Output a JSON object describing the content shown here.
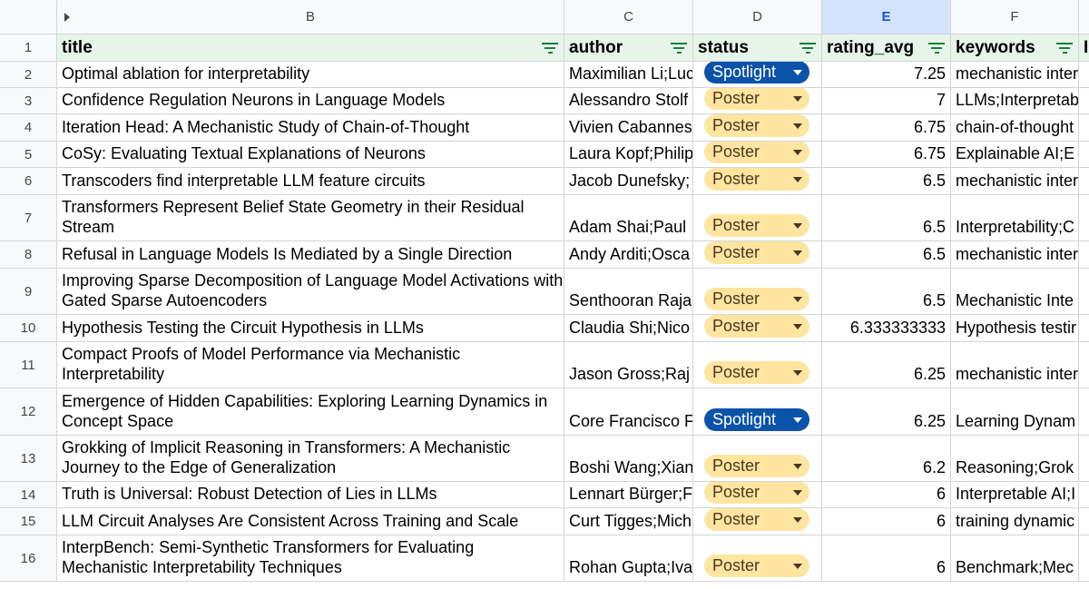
{
  "columns": [
    "B",
    "C",
    "D",
    "E",
    "F"
  ],
  "selected_column": "E",
  "headers": {
    "title": "title",
    "author": "author",
    "status": "status",
    "rating": "rating_avg",
    "keywords": "keywords",
    "next": "I"
  },
  "rows": [
    {
      "num": "1"
    },
    {
      "num": "2",
      "title": "Optimal ablation for interpretability",
      "author": "Maximilian Li;Luc",
      "status": "Spotlight",
      "rating": "7.25",
      "keywords": "mechanistic interp"
    },
    {
      "num": "3",
      "title": "Confidence Regulation Neurons in Language Models",
      "author": "Alessandro Stolf",
      "status": "Poster",
      "rating": "7",
      "keywords": "LLMs;Interpretab"
    },
    {
      "num": "4",
      "title": "Iteration Head: A Mechanistic Study of Chain-of-Thought",
      "author": "Vivien Cabannes",
      "status": "Poster",
      "rating": "6.75",
      "keywords": "chain-of-thought"
    },
    {
      "num": "5",
      "title": "CoSy: Evaluating Textual Explanations of Neurons",
      "author": "Laura Kopf;Philip",
      "status": "Poster",
      "rating": "6.75",
      "keywords": "Explainable AI;E"
    },
    {
      "num": "6",
      "title": "Transcoders find interpretable LLM feature circuits",
      "author": "Jacob Dunefsky;",
      "status": "Poster",
      "rating": "6.5",
      "keywords": "mechanistic inter"
    },
    {
      "num": "7",
      "title": "Transformers Represent Belief State Geometry in their Residual Stream",
      "author": "Adam Shai;Paul",
      "status": "Poster",
      "rating": "6.5",
      "keywords": "Interpretability;C"
    },
    {
      "num": "8",
      "title": "Refusal in Language Models Is Mediated by a Single Direction",
      "author": "Andy Arditi;Osca",
      "status": "Poster",
      "rating": "6.5",
      "keywords": "mechanistic inter"
    },
    {
      "num": "9",
      "title": "Improving Sparse Decomposition of Language Model Activations with Gated Sparse Autoencoders",
      "author": "Senthooran Raja",
      "status": "Poster",
      "rating": "6.5",
      "keywords": "Mechanistic Inte"
    },
    {
      "num": "10",
      "title": "Hypothesis Testing the Circuit Hypothesis in LLMs",
      "author": "Claudia Shi;Nico",
      "status": "Poster",
      "rating": "6.333333333",
      "keywords": "Hypothesis testir"
    },
    {
      "num": "11",
      "title": "Compact Proofs of Model Performance via Mechanistic Interpretability",
      "author": "Jason Gross;Raj",
      "status": "Poster",
      "rating": "6.25",
      "keywords": "mechanistic inter"
    },
    {
      "num": "12",
      "title": "Emergence of Hidden Capabilities: Exploring Learning Dynamics in Concept Space",
      "author": "Core Francisco F",
      "status": "Spotlight",
      "rating": "6.25",
      "keywords": "Learning Dynam"
    },
    {
      "num": "13",
      "title": "Grokking of Implicit Reasoning in Transformers: A Mechanistic Journey to the Edge of Generalization",
      "author": "Boshi Wang;Xian",
      "status": "Poster",
      "rating": "6.2",
      "keywords": "Reasoning;Grok"
    },
    {
      "num": "14",
      "title": "Truth is Universal: Robust Detection of Lies in LLMs",
      "author": "Lennart Bürger;F",
      "status": "Poster",
      "rating": "6",
      "keywords": "Interpretable AI;I"
    },
    {
      "num": "15",
      "title": "LLM Circuit Analyses Are Consistent Across Training and Scale",
      "author": "Curt Tigges;Mich",
      "status": "Poster",
      "rating": "6",
      "keywords": "training dynamic"
    },
    {
      "num": "16",
      "title": "InterpBench: Semi-Synthetic Transformers for Evaluating Mechanistic Interpretability Techniques",
      "author": "Rohan Gupta;Iva",
      "status": "Poster",
      "rating": "6",
      "keywords": "Benchmark;Mec"
    }
  ]
}
